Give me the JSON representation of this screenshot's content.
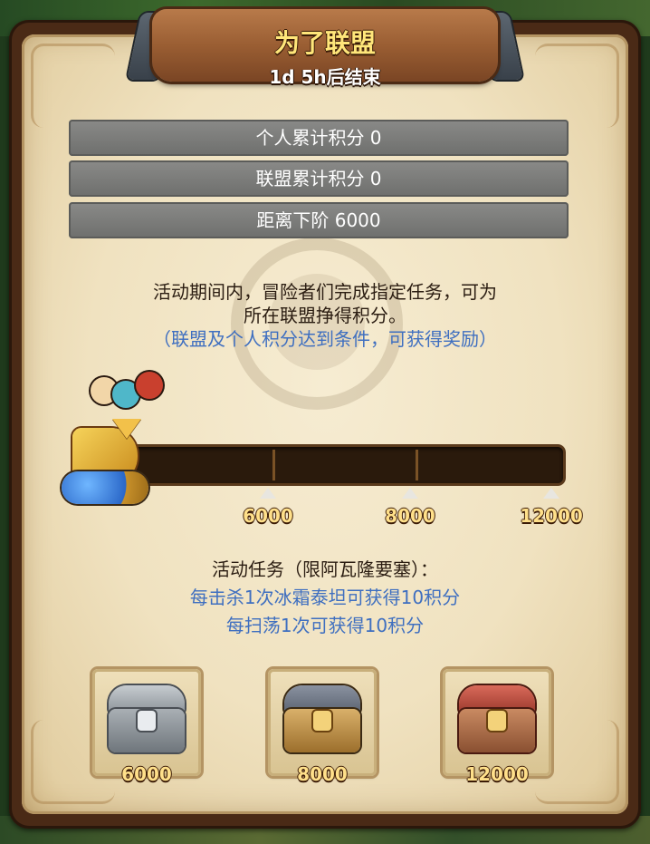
{
  "header": {
    "title": "为了联盟",
    "countdown": "1d 5h后结束"
  },
  "stats": {
    "personal_points": "个人累计积分 0",
    "alliance_points": "联盟累计积分 0",
    "next_tier": "距离下阶 6000"
  },
  "description": {
    "line1": "活动期间内，冒险者们完成指定任务，可为",
    "line2": "所在联盟挣得积分。",
    "note": "（联盟及个人积分达到条件，可获得奖励）"
  },
  "progress": {
    "current": 0,
    "max": 12000,
    "milestones": [
      "6000",
      "8000",
      "12000"
    ]
  },
  "tasks": {
    "title": "活动任务（限阿瓦隆要塞）：",
    "items": [
      "每击杀1次冰霜泰坦可获得10积分",
      "每扫荡1次可获得10积分"
    ]
  },
  "rewards": [
    {
      "label": "6000",
      "icon": "silver-chest-icon",
      "color": "#9aa0a6"
    },
    {
      "label": "8000",
      "icon": "gold-chest-icon",
      "color": "#c9a35a"
    },
    {
      "label": "12000",
      "icon": "red-chest-icon",
      "color": "#c9694f"
    }
  ],
  "colors": {
    "title_text": "#ffe67a",
    "accent_blue": "#3f6fc0",
    "milestone_text": "#ffe08a",
    "stat_bar": "#7c7d7b"
  }
}
